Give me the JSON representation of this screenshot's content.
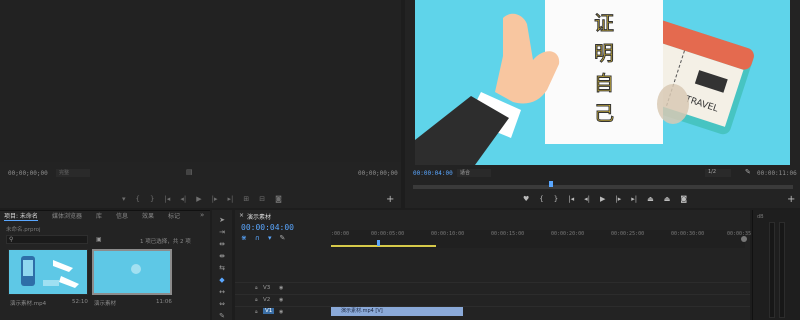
{
  "source_monitor": {
    "timecode_left": "00;00;00;00",
    "timecode_right": "00;00;00;00",
    "zoom_select": "完整"
  },
  "program_monitor": {
    "timecode_left": "00:00:04:00",
    "fit_select": "适合",
    "quality_select": "1/2",
    "timecode_right": "00:00:11:06",
    "card_text": [
      "证",
      "明",
      "自",
      "己"
    ],
    "ticket_text": "TRAVEL",
    "colors": {
      "bg": "#5fd4ea",
      "sleeve": "#2d2d2d",
      "hand": "#f8c6a0",
      "ticket": "#e46a4f",
      "ticket_strip": "#47c4c2"
    }
  },
  "project_panel": {
    "tabs": [
      "项目: 未命名",
      "媒体浏览器",
      "库",
      "信息",
      "效果",
      "标记"
    ],
    "project_file": "未命名.prproj",
    "selection_count": "1 项已选择，共 2 项",
    "items": [
      {
        "name": "演示素材.mp4",
        "duration": "52:10",
        "icon": "video-thumbnail"
      },
      {
        "name": "演示素材",
        "duration": "11:06",
        "icon": "sequence-thumbnail"
      }
    ]
  },
  "timeline": {
    "sequence_tab": "演示素材",
    "timecode": "00:00:04:00",
    "ruler_labels": [
      ":00:00",
      "00:00:05:00",
      "00:00:10:00",
      "00:00:15:00",
      "00:00:20:00",
      "00:00:25:00",
      "00:00:30:00",
      "00:00:35:00"
    ],
    "tracks": [
      {
        "name": "V3",
        "active": false
      },
      {
        "name": "V2",
        "active": false
      },
      {
        "name": "V1",
        "active": true
      }
    ],
    "clip_label": "演示素材.mp4 [V]"
  },
  "meter": {
    "label": "dB"
  }
}
